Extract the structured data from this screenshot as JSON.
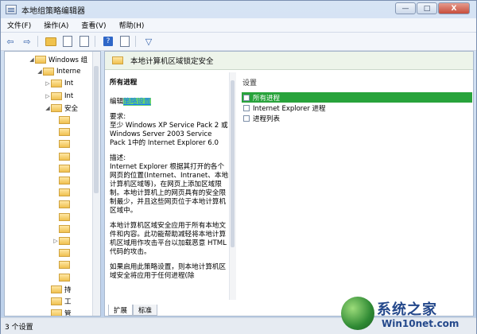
{
  "window": {
    "title": "本地组策略编辑器",
    "buttons": {
      "minimize": "—",
      "maximize": "□",
      "close": "X"
    }
  },
  "menu": [
    "文件(F)",
    "操作(A)",
    "查看(V)",
    "帮助(H)"
  ],
  "toolbar": {
    "icons": [
      "back-arrow-icon",
      "forward-arrow-icon",
      "folder-up-icon",
      "show-tree-icon",
      "export-icon",
      "help-icon",
      "properties-icon",
      "filter-icon"
    ],
    "back": "⇦",
    "forward": "⇨",
    "filter": "▽"
  },
  "tree": {
    "items": [
      {
        "label": "Windows 组",
        "indent": 2,
        "expander": "◢"
      },
      {
        "label": "Interne",
        "indent": 3,
        "expander": "◢"
      },
      {
        "label": "Int",
        "indent": 4,
        "expander": "▷"
      },
      {
        "label": "Int",
        "indent": 4,
        "expander": "▷"
      },
      {
        "label": "安全",
        "indent": 4,
        "expander": "◢"
      },
      {
        "label": "",
        "indent": 5,
        "expander": ""
      },
      {
        "label": "",
        "indent": 5,
        "expander": ""
      },
      {
        "label": "",
        "indent": 5,
        "expander": ""
      },
      {
        "label": "",
        "indent": 5,
        "expander": ""
      },
      {
        "label": "",
        "indent": 5,
        "expander": ""
      },
      {
        "label": "",
        "indent": 5,
        "expander": ""
      },
      {
        "label": "",
        "indent": 5,
        "expander": ""
      },
      {
        "label": "",
        "indent": 5,
        "expander": ""
      },
      {
        "label": "",
        "indent": 5,
        "expander": ""
      },
      {
        "label": "",
        "indent": 5,
        "expander": ""
      },
      {
        "label": "",
        "indent": 5,
        "expander": "▷"
      },
      {
        "label": "",
        "indent": 5,
        "expander": ""
      },
      {
        "label": "",
        "indent": 5,
        "expander": ""
      },
      {
        "label": "",
        "indent": 5,
        "expander": ""
      },
      {
        "label": "持",
        "indent": 4,
        "expander": ""
      },
      {
        "label": "工",
        "indent": 4,
        "expander": ""
      },
      {
        "label": "管",
        "indent": 4,
        "expander": ""
      }
    ]
  },
  "main": {
    "header_title": "本地计算机区域锁定安全",
    "desc_title": "所有进程",
    "edit_prefix": "编辑",
    "edit_link": "策略设置",
    "requirements": "要求:\n至少 Windows XP Service Pack 2 或 Windows Server 2003 Service Pack 1中的 Internet Explorer 6.0",
    "description": "描述:\nInternet Explorer 根据其打开的各个网页的位置(Internet、Intranet、本地计算机区域等)，在网页上添加区域限制。本地计算机上的网页具有的安全限制最少，并且这些网页位于本地计算机区域中。",
    "paragraph2": "本地计算机区域安全应用于所有本地文件和内容。此功能帮助减轻将本地计算机区域用作攻击平台以加载恶意 HTML 代码的攻击。",
    "paragraph3": "如果启用此策略设置，则本地计算机区域安全将应用于任何进程(除",
    "settings_header": "设置",
    "settings": [
      {
        "label": "所有进程",
        "selected": true
      },
      {
        "label": "Internet Explorer 进程",
        "selected": false
      },
      {
        "label": "进程列表",
        "selected": false
      }
    ],
    "tabs": [
      "扩展",
      "标准"
    ]
  },
  "status": {
    "text": "3 个设置"
  },
  "watermark": {
    "title": "系统之家",
    "site": "Win10net.com"
  }
}
